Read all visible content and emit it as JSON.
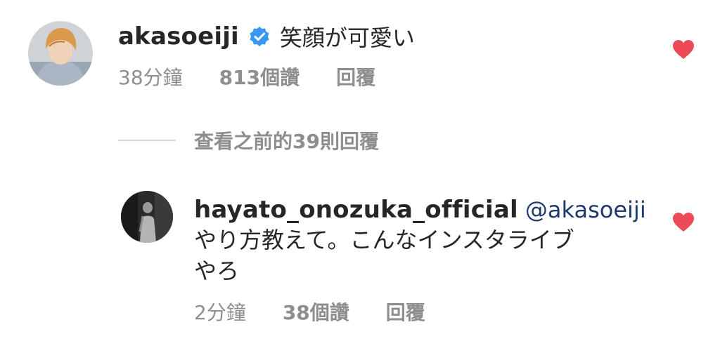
{
  "comment": {
    "username": "akasoeiji",
    "verified": true,
    "text": "笑顔が可愛い",
    "time": "38分鐘",
    "likes": "813個讚",
    "reply_label": "回覆",
    "liked": true,
    "heart_color": "#ed4956"
  },
  "view_replies": {
    "label": "查看之前的39則回覆"
  },
  "reply": {
    "username": "hayato_onozuka_official",
    "mention": "@akasoeiji",
    "text_line1": "やり方教えて。こんなインスタライブ",
    "text_line2": "やろ",
    "time": "2分鐘",
    "likes": "38個讚",
    "reply_label": "回覆",
    "liked": true
  },
  "colors": {
    "verified_badge": "#3897f0",
    "mention": "#1e3a6e",
    "meta": "#8e8e8e"
  }
}
